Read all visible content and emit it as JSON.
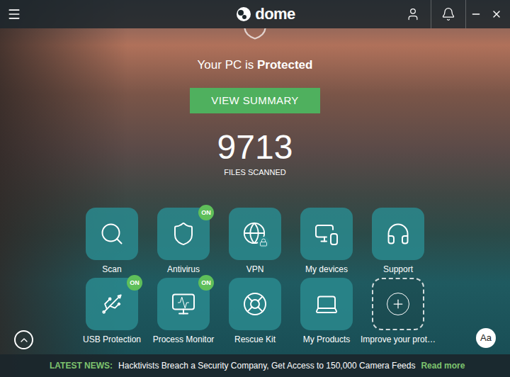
{
  "header": {
    "logo": "dome"
  },
  "status": {
    "prefix": "Your PC is ",
    "emphasis": "Protected"
  },
  "summary_button": "VIEW SUMMARY",
  "files_scanned": {
    "count": "9713",
    "label": "FILES SCANNED"
  },
  "tiles": [
    {
      "label": "Scan",
      "on": false,
      "badge": "",
      "kind": "feature"
    },
    {
      "label": "Antivirus",
      "on": true,
      "badge": "ON",
      "kind": "feature"
    },
    {
      "label": "VPN",
      "on": false,
      "badge": "",
      "kind": "feature"
    },
    {
      "label": "My devices",
      "on": false,
      "badge": "",
      "kind": "feature"
    },
    {
      "label": "Support",
      "on": false,
      "badge": "",
      "kind": "feature"
    },
    {
      "label": "USB Protection",
      "on": true,
      "badge": "ON",
      "kind": "feature"
    },
    {
      "label": "Process Monitor",
      "on": true,
      "badge": "ON",
      "kind": "feature"
    },
    {
      "label": "Rescue Kit",
      "on": false,
      "badge": "",
      "kind": "feature"
    },
    {
      "label": "My Products",
      "on": false,
      "badge": "",
      "kind": "feature"
    },
    {
      "label": "Improve your prot…",
      "on": false,
      "badge": "",
      "kind": "add"
    }
  ],
  "font_button": "Aa",
  "news": {
    "label": "LATEST NEWS:",
    "headline": "Hacktivists Breach a Security Company, Get Access to 150,000 Camera Feeds",
    "link": "Read more"
  }
}
